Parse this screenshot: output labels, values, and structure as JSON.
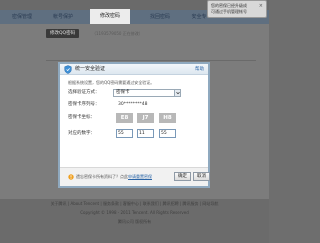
{
  "nav": {
    "tabs": [
      {
        "label": "密保管理"
      },
      {
        "label": "帐号保护"
      },
      {
        "label": "修改密码"
      },
      {
        "label": "找回密码"
      },
      {
        "label": "安全专"
      }
    ]
  },
  "tooltip": {
    "line1": "您的密保已经升级成",
    "line2": "可通过手机管理帐号",
    "close": "×"
  },
  "page": {
    "title_chip": "修改QQ密码",
    "note": "（1193579050 正在修改）"
  },
  "dialog": {
    "title": "统一安全验证",
    "help": "帮助",
    "description": "根据系统设置，您的QQ密码需要通过安全验证。",
    "verify_method_label": "选择验证方式：",
    "verify_method_value": "密保卡",
    "card_serial_label": "密保卡序列号：",
    "card_serial_value": "30********48",
    "coord_label": "密保卡坐标：",
    "coords": [
      "E8",
      "J7",
      "H8"
    ],
    "digit_label": "对应的数字：",
    "digits": [
      "55",
      "11",
      "55"
    ],
    "footer_text": "遗忘密保卡所有资料了？点此",
    "footer_link": "申请重置密保",
    "ok": "确定",
    "cancel": "取消"
  },
  "footer": {
    "line1": "关于腾讯 | About Tencent | 服务条款 | 客服中心 | 联系我们 | 腾讯招聘 | 腾讯服务 | 网站导航",
    "line2": "Copyright © 1998 - 2011 Tencent. All Rights Reserved",
    "line3": "腾讯公司 版权所有"
  },
  "colors": {
    "accent_link": "#2a64a6",
    "dialog_border": "#8fa9bf"
  },
  "icons": {
    "dialog_icon": "shield-icon",
    "footer_icon": "info-icon",
    "select_icon": "chevron-down-icon"
  }
}
